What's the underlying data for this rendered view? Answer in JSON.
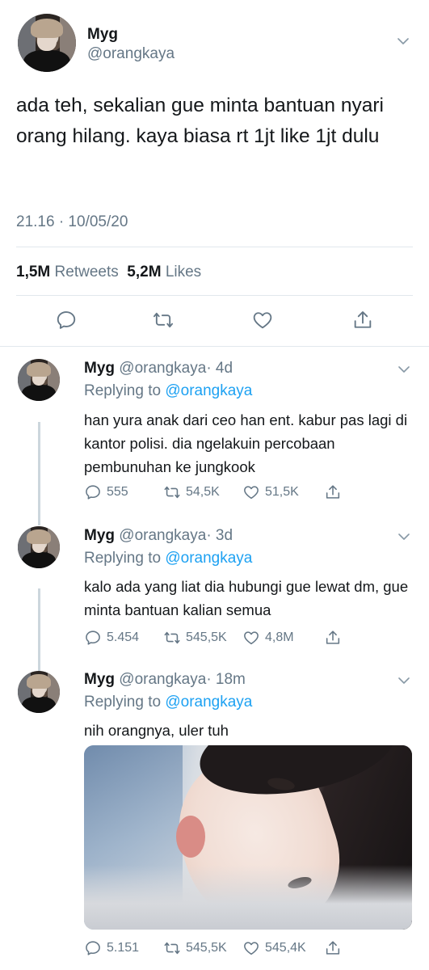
{
  "main_tweet": {
    "name": "Myg",
    "handle": "@orangkaya",
    "text": "ada teh, sekalian gue minta bantuan nyari orang hilang. kaya biasa rt 1jt like 1jt dulu",
    "timestamp": "21.16 · 10/05/20",
    "retweets_count": "1,5M",
    "retweets_label": "Retweets",
    "likes_count": "5,2M",
    "likes_label": "Likes"
  },
  "replies": [
    {
      "name": "Myg",
      "handle": "@orangkaya",
      "time": "· 4d",
      "replying_prefix": "Replying to",
      "replying_to": "@orangkaya",
      "text": "han yura anak dari ceo han ent. kabur pas lagi di kantor polisi. dia ngelakuin percobaan pembunuhan ke jungkook",
      "replies": "555",
      "retweets": "54,5K",
      "likes": "51,5K"
    },
    {
      "name": "Myg",
      "handle": "@orangkaya",
      "time": "· 3d",
      "replying_prefix": "Replying to",
      "replying_to": "@orangkaya",
      "text": "kalo ada yang liat dia hubungi gue lewat dm, gue minta bantuan kalian semua",
      "replies": "5.454",
      "retweets": "545,5K",
      "likes": "4,8M"
    },
    {
      "name": "Myg",
      "handle": "@orangkaya",
      "time": "· 18m",
      "replying_prefix": "Replying to",
      "replying_to": "@orangkaya",
      "text": "nih orangnya, uler tuh",
      "replies": "5.151",
      "retweets": "545,5K",
      "likes": "545,4K"
    }
  ],
  "colors": {
    "link": "#1da1f2",
    "secondary_text": "#657786",
    "divider": "#e1e8ed",
    "thread_line": "#ccd6dd"
  },
  "icons": [
    "reply-icon",
    "retweet-icon",
    "like-icon",
    "share-icon",
    "chevron-down-icon"
  ]
}
